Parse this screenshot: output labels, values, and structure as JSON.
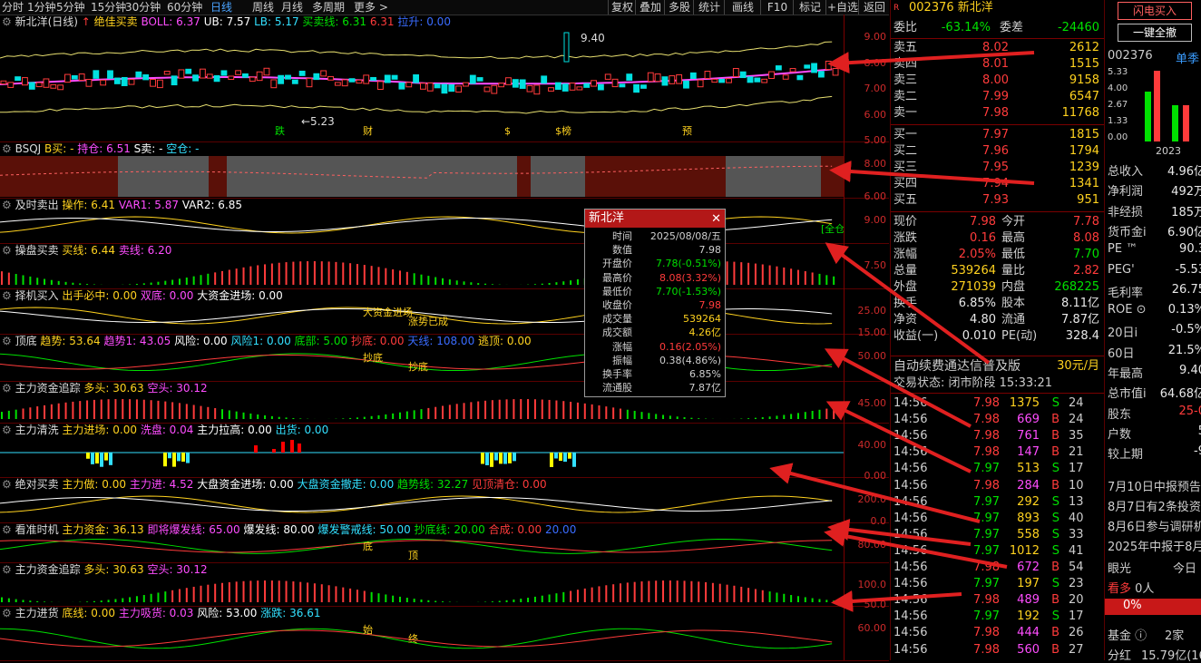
{
  "toolbar": {
    "periods": [
      "分时",
      "1分钟",
      "5分钟",
      "15分钟",
      "30分钟",
      "60分钟",
      "日线",
      "周线",
      "月线",
      "多周期",
      "更多 >"
    ],
    "active": "日线",
    "right": [
      "复权",
      "叠加",
      "多股",
      "统计",
      "画线",
      "F10",
      "标记",
      "+自选",
      "返回"
    ]
  },
  "panes": [
    {
      "title": "新北洋(日线)",
      "fields": [
        [
          "绝佳买卖",
          ""
        ],
        [
          "BOLL:",
          "6.37"
        ],
        [
          "UB:",
          "7.57"
        ],
        [
          "LB:",
          "5.17"
        ],
        [
          "买卖线:",
          "6.31"
        ],
        [
          "",
          "6.31"
        ],
        [
          "拉升:",
          "0.00"
        ]
      ],
      "ticks": [
        "9.00",
        "8.00",
        "7.00",
        "6.00",
        "5.00"
      ],
      "labels": [
        "跌",
        "财",
        "$",
        "$榜",
        "预"
      ],
      "hi": "9.40",
      "lo": "5.23"
    },
    {
      "title": "BSQJ",
      "fields": [
        [
          "B买:",
          "-"
        ],
        [
          "持仓:",
          "6.51"
        ],
        [
          "S卖:",
          "-"
        ],
        [
          "空仓:",
          "-"
        ]
      ],
      "ticks": [
        "8.00",
        "6.00"
      ]
    },
    {
      "title": "及时卖出",
      "fields": [
        [
          "操作:",
          "6.41"
        ],
        [
          "VAR1:",
          "5.87"
        ],
        [
          "VAR2:",
          "6.85"
        ]
      ],
      "ticks": [
        "9.00"
      ],
      "label": "[全仓"
    },
    {
      "title": "操盘买卖",
      "fields": [
        [
          "买线:",
          "6.44"
        ],
        [
          "卖线:",
          "6.20"
        ]
      ],
      "ticks": [
        "7.50"
      ]
    },
    {
      "title": "择机买入",
      "fields": [
        [
          "出手必中:",
          "0.00"
        ],
        [
          "双底:",
          "0.00"
        ],
        [
          "大资金进场:",
          "0.00"
        ]
      ],
      "ticks": [
        "25.00",
        "15.00"
      ],
      "notes": [
        "大资金进场",
        "涨势已成"
      ]
    },
    {
      "title": "顶底",
      "fields": [
        [
          "趋势:",
          "53.64"
        ],
        [
          "趋势1:",
          "43.05"
        ],
        [
          "风险:",
          "0.00"
        ],
        [
          "风险1:",
          "0.00"
        ],
        [
          "底部:",
          "5.00"
        ],
        [
          "抄底:",
          "0.00"
        ],
        [
          "天线:",
          "108.00"
        ],
        [
          "逃顶:",
          "0.00"
        ]
      ],
      "ticks": [
        "50.00"
      ],
      "notes": [
        "抄底",
        "抄底"
      ]
    },
    {
      "title": "主力资金追踪",
      "fields": [
        [
          "多头:",
          "30.63"
        ],
        [
          "空头:",
          "30.12"
        ]
      ],
      "ticks": [
        "45.00"
      ]
    },
    {
      "title": "主力清洗",
      "fields": [
        [
          "主力进场:",
          "0.00"
        ],
        [
          "洗盘:",
          "0.04"
        ],
        [
          "主力拉高:",
          "0.00"
        ],
        [
          "出货:",
          "0.00"
        ]
      ],
      "ticks": [
        "40.00",
        "0.00"
      ]
    },
    {
      "title": "绝对买卖",
      "fields": [
        [
          "主力做:",
          "0.00"
        ],
        [
          "主力进:",
          "4.52"
        ],
        [
          "大盘资金进场:",
          "0.00"
        ],
        [
          "大盘资金撤走:",
          "0.00"
        ],
        [
          "趋势线:",
          "32.27"
        ],
        [
          "见顶清仓:",
          "0.00"
        ]
      ],
      "ticks": [
        "200.0",
        "0.0"
      ]
    },
    {
      "title": "看准时机",
      "fields": [
        [
          "主力资金:",
          "36.13"
        ],
        [
          "即将爆发线:",
          "65.00"
        ],
        [
          "爆发线:",
          "80.00"
        ],
        [
          "爆发警戒线:",
          "50.00"
        ],
        [
          "抄底线:",
          "20.00"
        ],
        [
          "合成:",
          "0.00"
        ],
        [
          "",
          "20.00"
        ]
      ],
      "ticks": [
        "80.00"
      ],
      "notes": [
        "底",
        "顶"
      ]
    },
    {
      "title": "主力资金追踪",
      "fields": [
        [
          "多头:",
          "30.63"
        ],
        [
          "空头:",
          "30.12"
        ]
      ],
      "ticks": [
        "100.0",
        "50.0"
      ]
    },
    {
      "title": "主力进货",
      "fields": [
        [
          "底线:",
          "0.00"
        ],
        [
          "主力吸货:",
          "0.03"
        ],
        [
          "风险:",
          "53.00"
        ],
        [
          "涨跌:",
          "36.61"
        ]
      ],
      "ticks": [
        "60.00"
      ],
      "notes": [
        "始",
        "终"
      ]
    }
  ],
  "popup": {
    "title": "新北洋",
    "rows": [
      [
        "时间",
        "2025/08/08/五"
      ],
      [
        "数值",
        "7.98"
      ],
      [
        "开盘价",
        "7.78(-0.51%)"
      ],
      [
        "最高价",
        "8.08(3.32%)"
      ],
      [
        "最低价",
        "7.70(-1.53%)"
      ],
      [
        "收盘价",
        "7.98"
      ],
      [
        "成交量",
        "539264"
      ],
      [
        "成交额",
        "4.26亿"
      ],
      [
        "涨幅",
        "0.16(2.05%)"
      ],
      [
        "振幅",
        "0.38(4.86%)"
      ],
      [
        "换手率",
        "6.85%"
      ],
      [
        "流通股",
        "7.87亿"
      ]
    ]
  },
  "quote": {
    "code": "002376",
    "name": "新北洋",
    "weibi": [
      "委比",
      "-63.14%",
      "委差",
      "-24460"
    ],
    "asks": [
      [
        "卖五",
        "8.02",
        "2612"
      ],
      [
        "卖四",
        "8.01",
        "1515"
      ],
      [
        "卖三",
        "8.00",
        "9158"
      ],
      [
        "卖二",
        "7.99",
        "6547"
      ],
      [
        "卖一",
        "7.98",
        "11768"
      ]
    ],
    "bids": [
      [
        "买一",
        "7.97",
        "1815"
      ],
      [
        "买二",
        "7.96",
        "1794"
      ],
      [
        "买三",
        "7.95",
        "1239"
      ],
      [
        "买四",
        "7.94",
        "1341"
      ],
      [
        "买五",
        "7.93",
        "951"
      ]
    ],
    "stats": [
      [
        "现价",
        "7.98",
        "今开",
        "7.78"
      ],
      [
        "涨跌",
        "0.16",
        "最高",
        "8.08"
      ],
      [
        "涨幅",
        "2.05%",
        "最低",
        "7.70"
      ],
      [
        "总量",
        "539264",
        "量比",
        "2.82"
      ],
      [
        "外盘",
        "271039",
        "内盘",
        "268225"
      ],
      [
        "换手",
        "6.85%",
        "股本",
        "8.11亿"
      ],
      [
        "净资",
        "4.80",
        "流通",
        "7.87亿"
      ],
      [
        "收益(一)",
        "0.010",
        "PE(动)",
        "328.4"
      ]
    ],
    "promo": "自动续费通达信普及版",
    "price": "30元/月",
    "status": "交易状态: 闭市阶段 15:33:21",
    "ticks": [
      [
        "14:56",
        "7.98",
        "1375",
        "S",
        "24"
      ],
      [
        "14:56",
        "7.98",
        "669",
        "B",
        "24"
      ],
      [
        "14:56",
        "7.98",
        "761",
        "B",
        "35"
      ],
      [
        "14:56",
        "7.98",
        "147",
        "B",
        "21"
      ],
      [
        "14:56",
        "7.97",
        "513",
        "S",
        "17"
      ],
      [
        "14:56",
        "7.98",
        "284",
        "B",
        "10"
      ],
      [
        "14:56",
        "7.97",
        "292",
        "S",
        "13"
      ],
      [
        "14:56",
        "7.97",
        "893",
        "S",
        "40"
      ],
      [
        "14:56",
        "7.97",
        "558",
        "S",
        "33"
      ],
      [
        "14:56",
        "7.97",
        "1012",
        "S",
        "41"
      ],
      [
        "14:56",
        "7.98",
        "672",
        "B",
        "54"
      ],
      [
        "14:56",
        "7.97",
        "197",
        "S",
        "23"
      ],
      [
        "14:56",
        "7.98",
        "489",
        "B",
        "20"
      ],
      [
        "14:56",
        "7.97",
        "192",
        "S",
        "17"
      ],
      [
        "14:56",
        "7.98",
        "444",
        "B",
        "26"
      ],
      [
        "14:56",
        "7.98",
        "560",
        "B",
        "27"
      ]
    ]
  },
  "side": {
    "btn1": "闪电买入",
    "btn2": "一键全撤",
    "code": "002376",
    "mode": "单季",
    "yticks": [
      "5.33",
      "4.00",
      "2.67",
      "1.33",
      "0.00"
    ],
    "year": "2023",
    "rows": [
      [
        "总收入",
        "4.96亿"
      ],
      [
        "净利润",
        "492万"
      ],
      [
        "非经损",
        "185万"
      ],
      [
        "货币金i",
        "6.90亿"
      ],
      [
        "PE ™",
        "90.3"
      ],
      [
        "PEG'",
        "-5.53"
      ],
      [
        "毛利率",
        "26.75"
      ],
      [
        "ROE ⊙",
        "0.13%"
      ],
      [
        "20日i",
        "-0.5%"
      ],
      [
        "60日",
        "21.5%"
      ],
      [
        "年最高",
        "9.40"
      ],
      [
        "总市值i",
        "64.68亿"
      ],
      [
        "股东",
        "25-0"
      ],
      [
        "户数",
        "5"
      ],
      [
        "较上期",
        "-9"
      ]
    ],
    "news": [
      "7月10日中报预告",
      "8月7日有2条投资",
      "8月6日参与调研机",
      "2025年中报于8月"
    ],
    "eye": "眼光",
    "today": "今日",
    "kan": "看多",
    "people": "0人",
    "pct": "0%",
    "jijin": "基金 ⓘ",
    "jijinv": "2家",
    "fenhong": "分红",
    "fenhongv": "15.79亿(16"
  },
  "colors": {
    "up": "#ff3b3b",
    "down": "#00e000",
    "yellow": "#ffd21f",
    "grid": "#7a0000"
  }
}
